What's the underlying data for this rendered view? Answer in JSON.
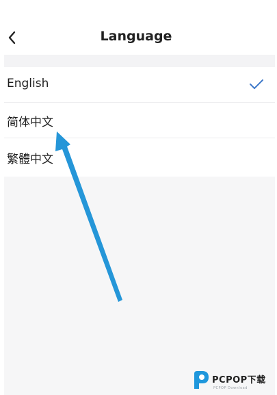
{
  "header": {
    "title": "Language",
    "back_icon": "chevron-left-icon"
  },
  "languages": [
    {
      "label": "English",
      "selected": true
    },
    {
      "label": "简体中文",
      "selected": false
    },
    {
      "label": "繁體中文",
      "selected": false
    }
  ],
  "selected_icon": "checkmark-icon",
  "watermark": {
    "text": "PCPOP下载",
    "subtext": "PCPOP Download"
  },
  "colors": {
    "accent": "#3d78c9",
    "arrow": "#2596d8",
    "background": "#f6f6f7",
    "surface": "#ffffff",
    "watermark_logo": "#1f97dc"
  }
}
